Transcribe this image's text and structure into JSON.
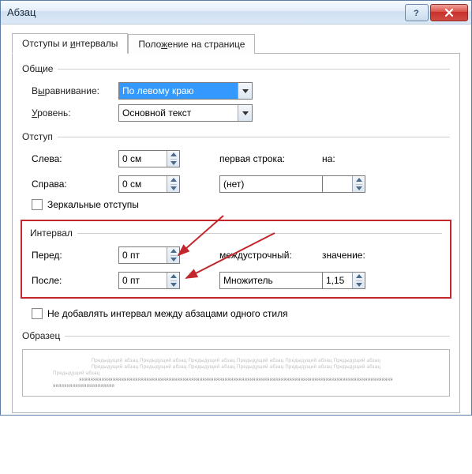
{
  "window": {
    "title": "Абзац"
  },
  "tabs": {
    "indents": "Отступы и интервалы",
    "position": "Положение на странице"
  },
  "groups": {
    "general": {
      "title": "Общие",
      "alignment_label": "Выравнивание:",
      "alignment_value": "По левому краю",
      "level_label": "Уровень:",
      "level_value": "Основной текст"
    },
    "indent": {
      "title": "Отступ",
      "left_label": "Слева:",
      "left_value": "0 см",
      "right_label": "Справа:",
      "right_value": "0 см",
      "firstline_label": "первая строка:",
      "firstline_value": "(нет)",
      "by_label": "на:",
      "by_value": "",
      "mirror_label": "Зеркальные отступы"
    },
    "interval": {
      "title": "Интервал",
      "before_label": "Перед:",
      "before_value": "0 пт",
      "after_label": "После:",
      "after_value": "0 пт",
      "line_label": "междустрочный:",
      "line_value": "Множитель",
      "value_label": "значение:",
      "value_value": "1,15",
      "noadd_label": "Не добавлять интервал между абзацами одного стиля"
    },
    "sample": {
      "title": "Образец",
      "line1": "Предыдущий абзац Предыдущий абзац Предыдущий абзац Предыдущий абзац Предыдущий абзац Предыдущий абзац",
      "line2": "Предыдущий абзац Предыдущий абзац Предыдущий абзац Предыдущий абзац Предыдущий абзац Предыдущий абзац",
      "line3": "Предыдущий абзац",
      "line4": "яяяяяяяяяяяяяяяяяяяяяяяяяяяяяяяяяяяяяяяяяяяяяяяяяяяяяяяяяяяяяяяяяяяяяяяяяяяяяяяяяяяяяяяяяяяяяяяяяяяяяяяяяяяяяяяя",
      "line5": "яяяяяяяяяяяяяяяяяяяяяя"
    }
  }
}
